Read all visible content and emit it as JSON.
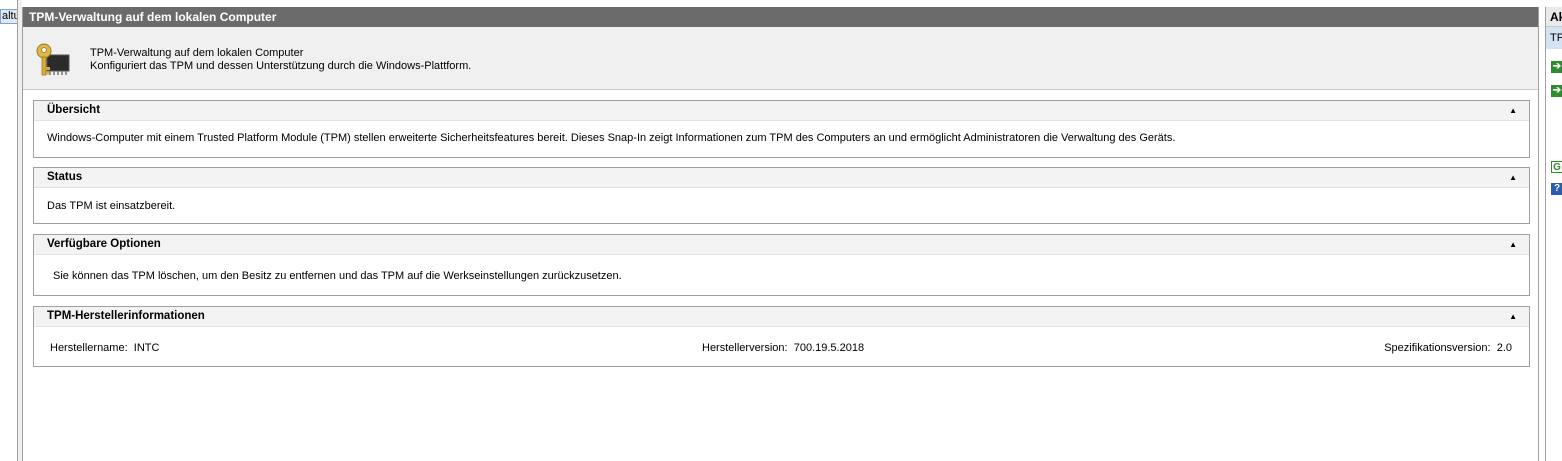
{
  "left_pane": {
    "tree_item_label": "altu"
  },
  "window": {
    "title": "TPM-Verwaltung auf dem lokalen Computer"
  },
  "header": {
    "line1": "TPM-Verwaltung auf dem lokalen Computer",
    "line2": "Konfiguriert das TPM und dessen Unterstützung durch die Windows-Plattform.",
    "icon": "key-chip-icon"
  },
  "sections": {
    "overview": {
      "title": "Übersicht",
      "text": "Windows-Computer mit einem Trusted Platform Module (TPM) stellen erweiterte Sicherheitsfeatures bereit. Dieses Snap-In zeigt Informationen zum TPM des Computers an und ermöglicht Administratoren die Verwaltung des Geräts."
    },
    "status": {
      "title": "Status",
      "text": "Das TPM ist einsatzbereit."
    },
    "options": {
      "title": "Verfügbare Optionen",
      "text": "Sie können das TPM löschen, um den Besitz zu entfernen und das TPM auf die Werkseinstellungen zurückzusetzen."
    },
    "manufacturer": {
      "title": "TPM-Herstellerinformationen",
      "name_label": "Herstellername:",
      "name_value": "INTC",
      "version_label": "Herstellerversion:",
      "version_value": "700.19.5.2018",
      "spec_label": "Spezifikationsversion:",
      "spec_value": "2.0"
    }
  },
  "collapse_glyph": "▲",
  "actions_pane": {
    "header": "Ak",
    "subheader": "TP"
  },
  "colors": {
    "title_bar": "#6b6b6b",
    "accent_green": "#2e8b2e",
    "accent_blue": "#2a5db0"
  }
}
